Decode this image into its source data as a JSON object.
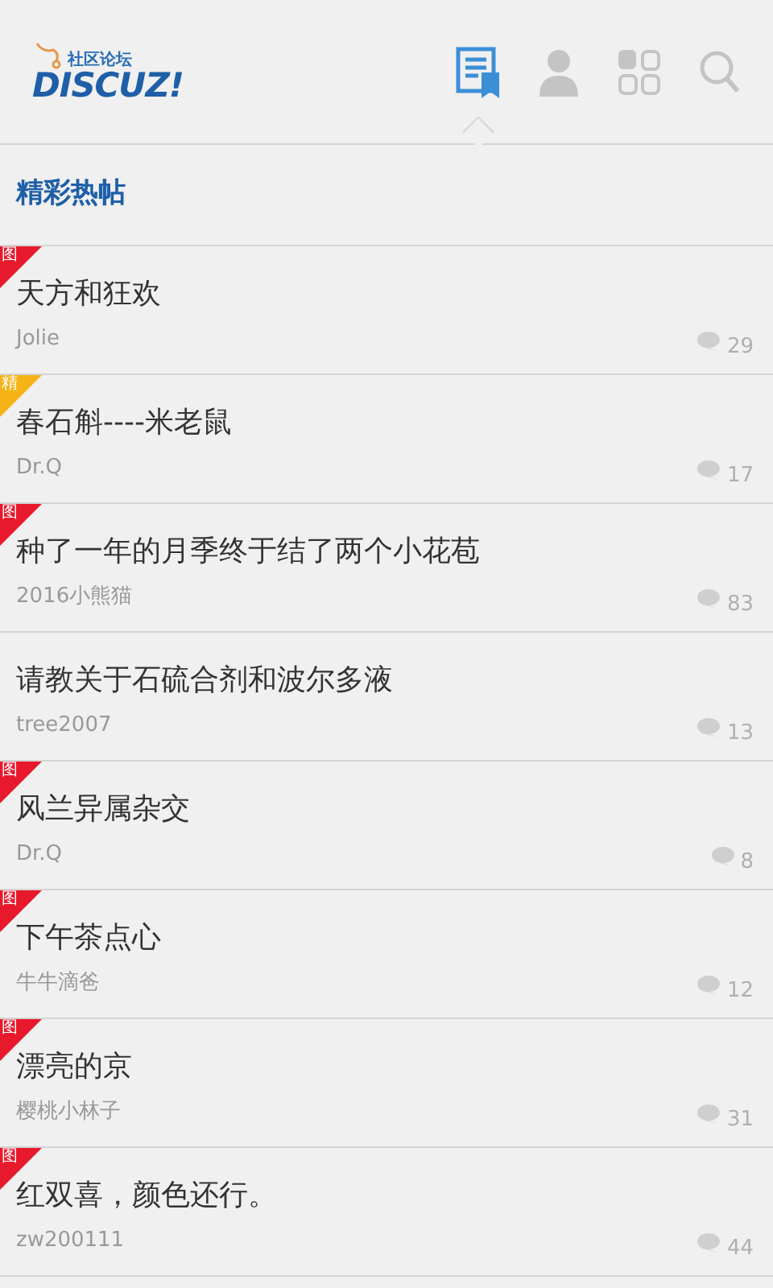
{
  "header": {
    "logo": {
      "subtitle": "社区论坛",
      "name": "DISCUZ!"
    },
    "tabs": [
      {
        "kind": "threads",
        "selected": true
      },
      {
        "kind": "profile",
        "selected": false
      },
      {
        "kind": "apps",
        "selected": false
      },
      {
        "kind": "search",
        "selected": false
      }
    ]
  },
  "section_title": "精彩热帖",
  "threads": [
    {
      "title": "天方和狂欢",
      "author": "Jolie",
      "replies": "29",
      "tag": {
        "label": "图",
        "color": "#e8192c"
      }
    },
    {
      "title": "春石斛----米老鼠",
      "author": "Dr.Q",
      "replies": "17",
      "tag": {
        "label": "精",
        "color": "#f5b316"
      }
    },
    {
      "title": "种了一年的月季终于结了两个小花苞",
      "author": "2016小熊猫",
      "replies": "83",
      "tag": {
        "label": "图",
        "color": "#e8192c"
      }
    },
    {
      "title": "请教关于石硫合剂和波尔多液",
      "author": "tree2007",
      "replies": "13"
    },
    {
      "title": "风兰异属杂交",
      "author": "Dr.Q",
      "replies": "8",
      "tag": {
        "label": "图",
        "color": "#e8192c"
      }
    },
    {
      "title": "下午茶点心",
      "author": "牛牛滴爸",
      "replies": "12",
      "tag": {
        "label": "图",
        "color": "#e8192c"
      }
    },
    {
      "title": "漂亮的京",
      "author": "樱桃小林子",
      "replies": "31",
      "tag": {
        "label": "图",
        "color": "#e8192c"
      }
    },
    {
      "title": "红双喜，颜色还行。",
      "author": "zw200111",
      "replies": "44",
      "tag": {
        "label": "图",
        "color": "#e8192c"
      }
    }
  ]
}
